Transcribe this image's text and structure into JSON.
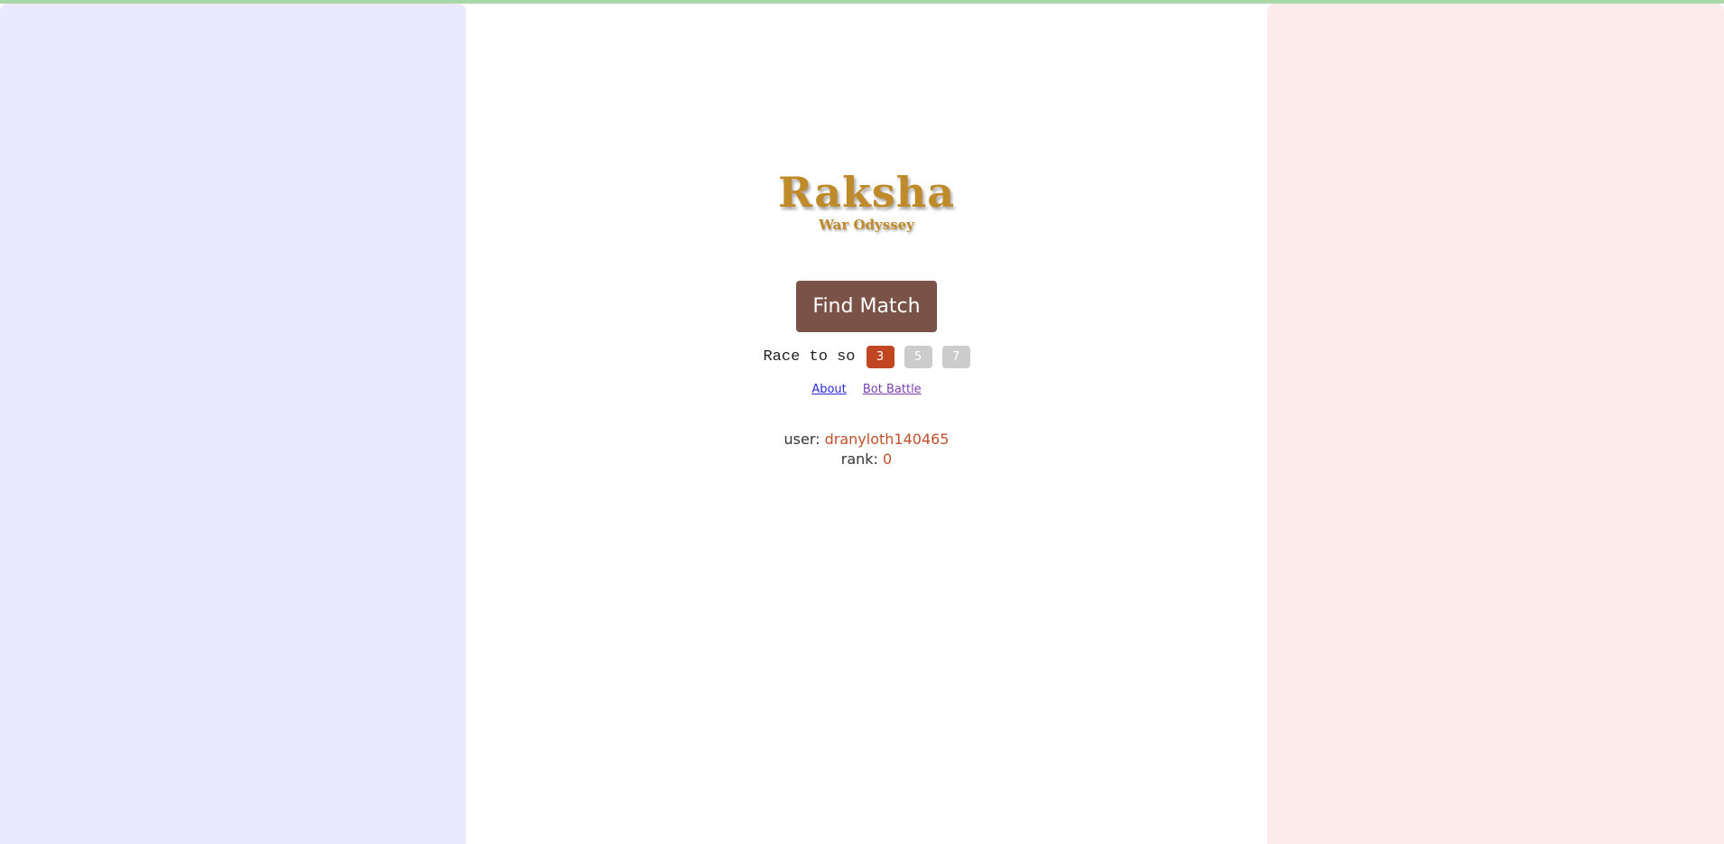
{
  "app": {
    "title": "Raksha",
    "subtitle": "War Odyssey"
  },
  "actions": {
    "find_match_label": "Find Match"
  },
  "race": {
    "label": "Race to so",
    "options": [
      "3",
      "5",
      "7"
    ],
    "selected": "3"
  },
  "links": {
    "about": "About",
    "bot_battle": "Bot Battle"
  },
  "user": {
    "user_label": "user:",
    "username": "dranyloth140465",
    "rank_label": "rank:",
    "rank": "0"
  },
  "colors": {
    "left_panel": "#ebe9ff",
    "right_panel": "#fdeaea",
    "brand_gold": "#bf8a2a",
    "find_match_bg": "#7a5248",
    "accent": "#bf4620"
  }
}
